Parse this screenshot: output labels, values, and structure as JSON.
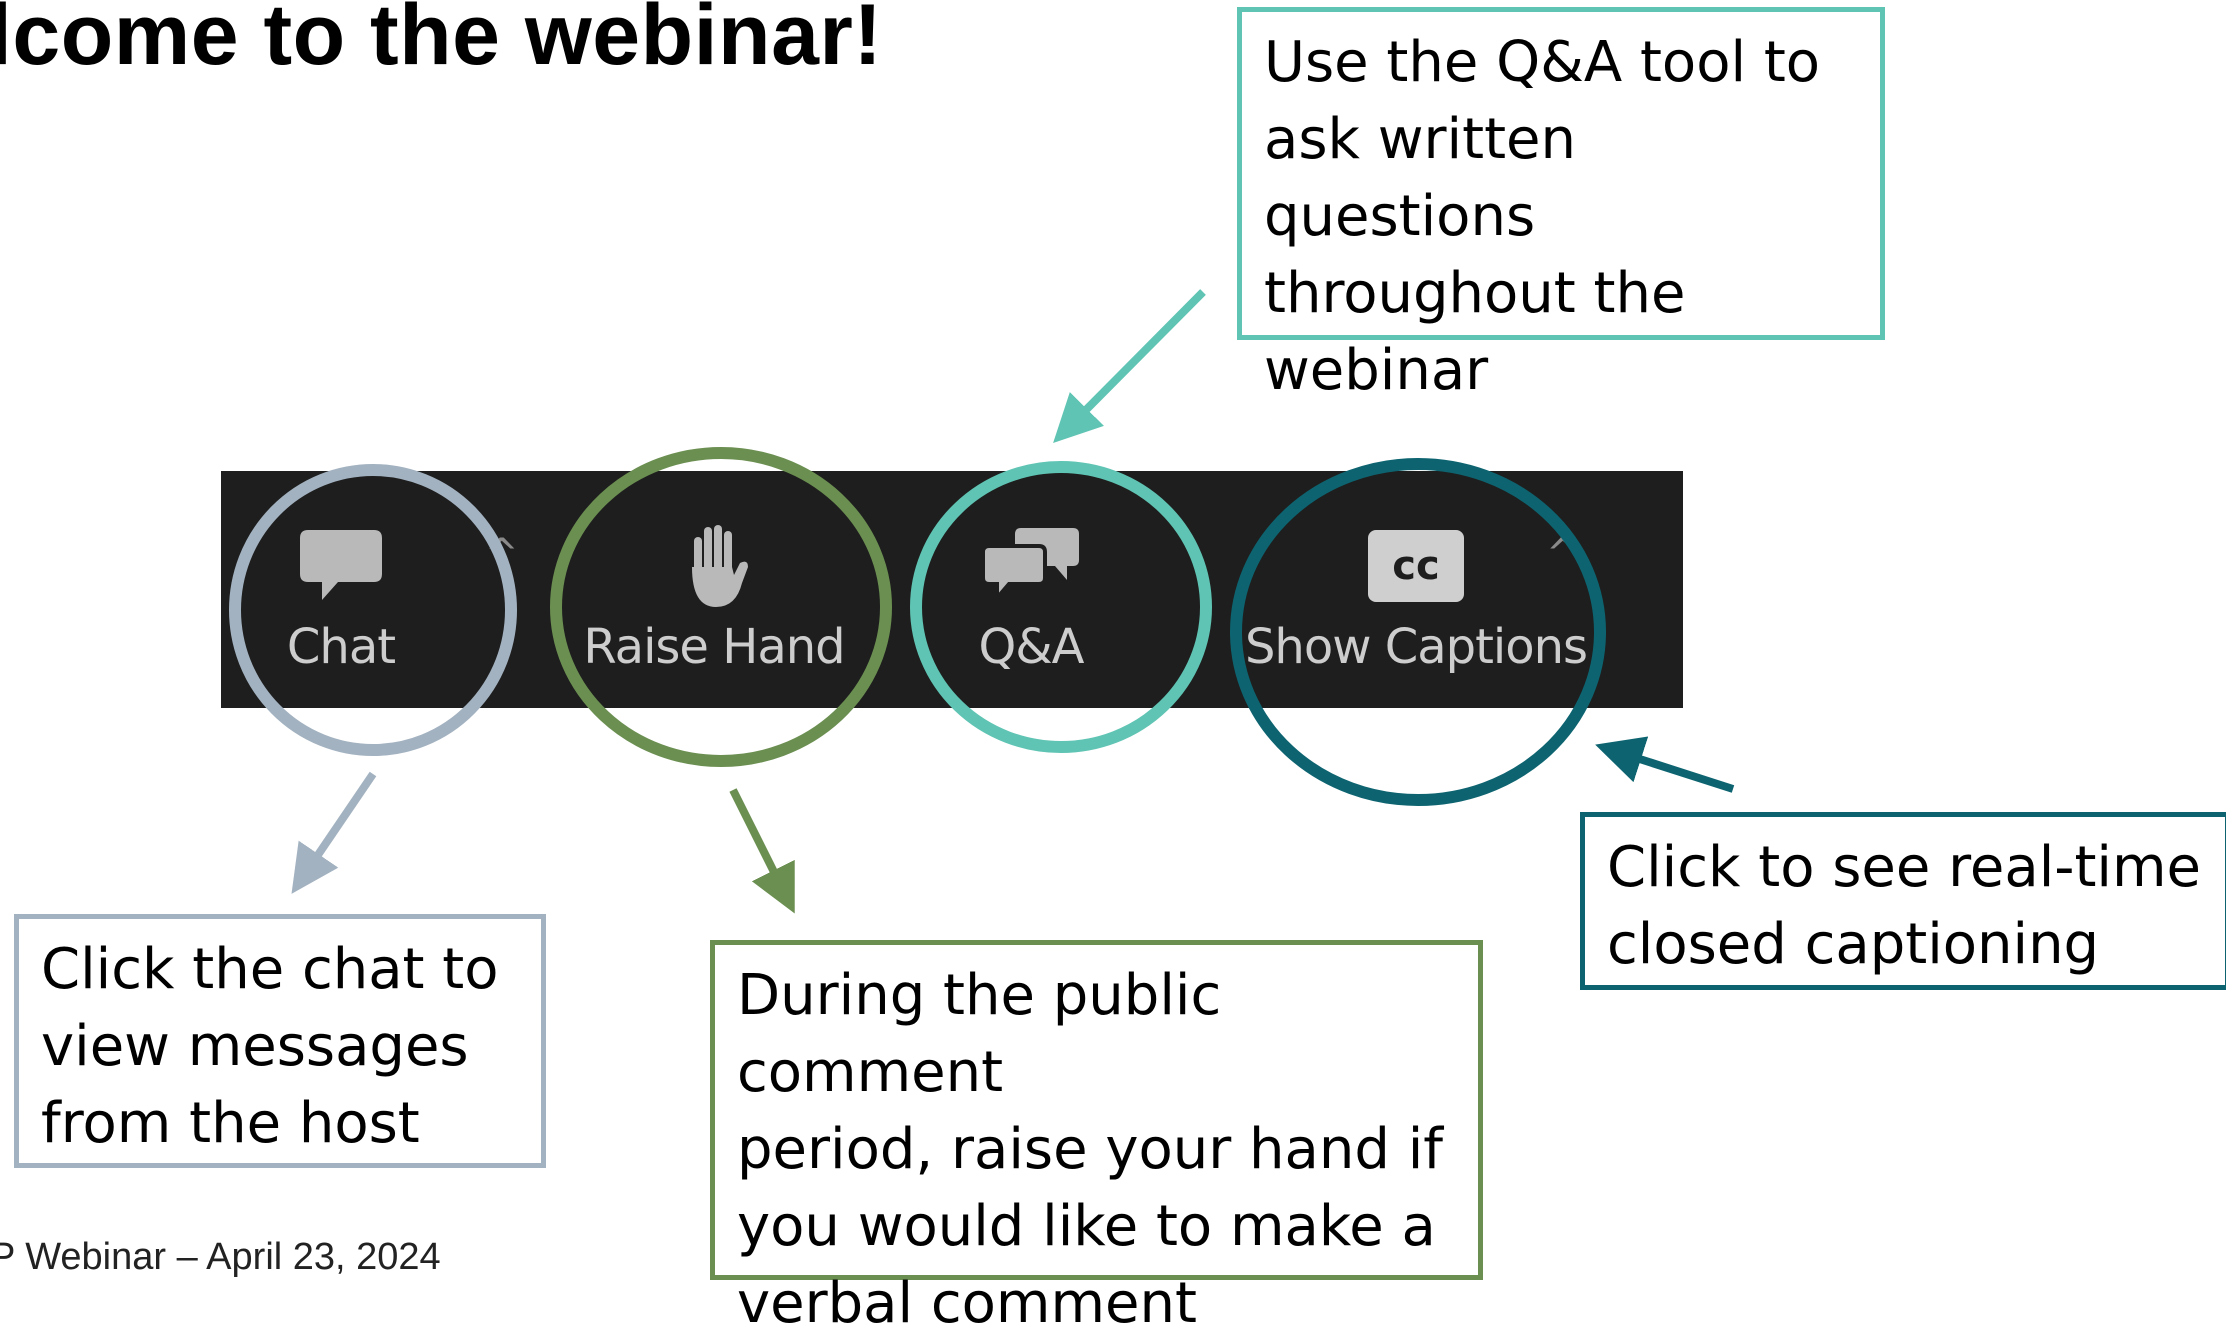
{
  "slide": {
    "title": "lcome to the webinar!",
    "footer": "P Webinar – April 23, 2024"
  },
  "toolbar": {
    "chat": {
      "label": "Chat",
      "icon": "chat-bubble-icon"
    },
    "raise_hand": {
      "label": "Raise Hand",
      "icon": "raised-hand-icon"
    },
    "qa": {
      "label": "Q&A",
      "icon": "qa-bubbles-icon"
    },
    "captions": {
      "label": "Show Captions",
      "icon": "cc-icon",
      "icon_text": "cc"
    }
  },
  "callouts": {
    "qa": [
      "Use the Q&A tool to",
      "ask written questions",
      "throughout the",
      "webinar"
    ],
    "chat": [
      "Click the chat to",
      "view messages",
      "from the host"
    ],
    "raise_hand": [
      "During the public comment",
      "period, raise your hand if",
      "you would like to make a",
      "verbal comment"
    ],
    "captions": [
      "Click to see real-time",
      "closed captioning"
    ]
  },
  "colors": {
    "chat": "#a3b2c0",
    "raise_hand": "#6b8f51",
    "qa": "#5fc4b3",
    "captions": "#0d6470",
    "toolbar_bg": "#1e1e1e",
    "toolbar_text": "#cdcdcd"
  }
}
